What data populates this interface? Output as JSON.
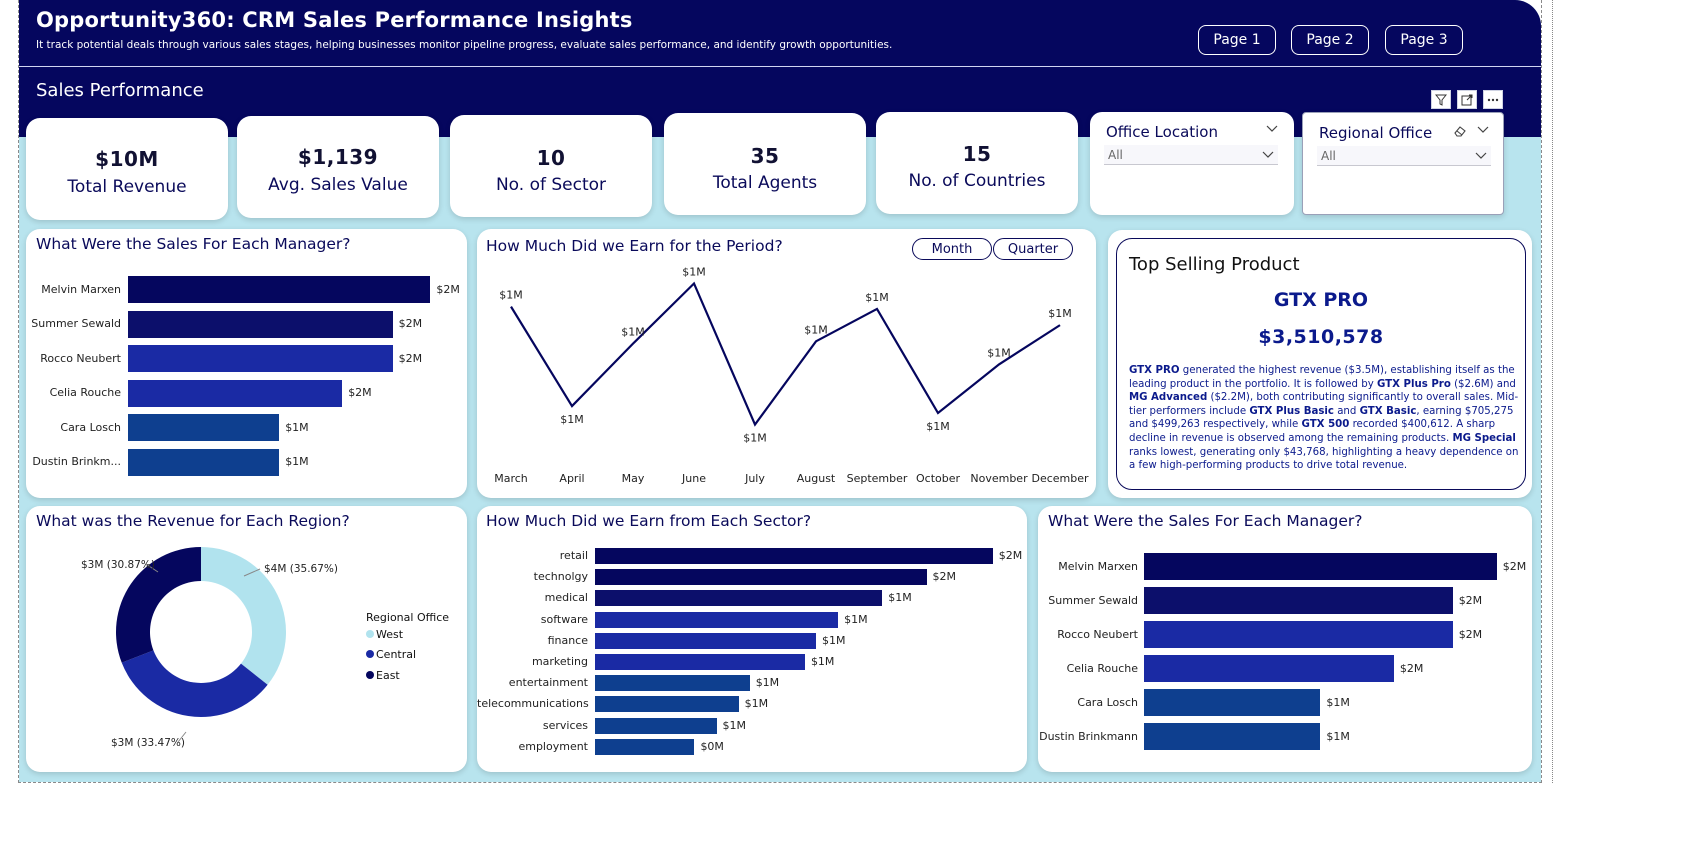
{
  "header": {
    "title": "Opportunity360: CRM Sales Performance Insights",
    "subtitle": "It track potential deals through various sales stages, helping businesses monitor pipeline progress, evaluate sales performance, and identify growth opportunities.",
    "section": "Sales Performance",
    "pages": [
      "Page 1",
      "Page 2",
      "Page 3"
    ],
    "visual_icons": [
      "filter-icon",
      "focus-mode-icon",
      "more-options-icon"
    ]
  },
  "kpis": [
    {
      "value": "$10M",
      "label": "Total Revenue"
    },
    {
      "value": "$1,139",
      "label": "Avg. Sales Value"
    },
    {
      "value": "10",
      "label": "No. of Sector"
    },
    {
      "value": "35",
      "label": "Total Agents"
    },
    {
      "value": "15",
      "label": "No. of Countries"
    }
  ],
  "slicers": [
    {
      "title": "Office Location",
      "selected": "All"
    },
    {
      "title": "Regional Office",
      "selected": "All"
    }
  ],
  "colors": {
    "navy": "#05065e",
    "dark_blue": "#0c0f6b",
    "royal_blue": "#1a2aa4",
    "mid_blue": "#0e3f8f",
    "light_blue": "#b1e3ee",
    "background": "#b8e4ee"
  },
  "manager_chart": {
    "title": "What Were the Sales For Each Manager?",
    "labels_full": [
      "Melvin Marxen",
      "Summer Sewald",
      "Rocco Neubert",
      "Celia Rouche",
      "Cara Losch",
      "Dustin Brinkmann"
    ],
    "labels_short": [
      "Melvin Marxen",
      "Summer Sewald",
      "Rocco Neubert",
      "Celia Rouche",
      "Cara Losch",
      "Dustin Brinkm..."
    ],
    "value_labels": [
      "$2M",
      "$2M",
      "$2M",
      "$2M",
      "$1M",
      "$1M"
    ]
  },
  "period_chart": {
    "title": "How Much Did we Earn for the Period?",
    "toggles": [
      "Month",
      "Quarter"
    ],
    "months": [
      "March",
      "April",
      "May",
      "June",
      "July",
      "August",
      "September",
      "October",
      "November",
      "December"
    ],
    "value_labels": [
      "$1M",
      "$1M",
      "$1M",
      "$1M",
      "$1M",
      "$1M",
      "$1M",
      "$1M",
      "$1M",
      "$1M"
    ]
  },
  "top_product": {
    "heading": "Top Selling Product",
    "name": "GTX PRO",
    "revenue": "$3,510,578",
    "t1": "GTX PRO",
    "t2": " generated the highest revenue ($3.5M), establishing itself as the leading product in the portfolio. It is followed by ",
    "t3": "GTX Plus Pro",
    "t4": " ($2.6M) and ",
    "t5": "MG Advanced",
    "t6": " ($2.2M), both contributing significantly to overall sales. Mid-tier performers include ",
    "t7": "GTX Plus Basic",
    "t8": " and ",
    "t9": "GTX Basic",
    "t10": ", earning $705,275 and $499,263 respectively, while ",
    "t11": "GTX 500",
    "t12": " recorded $400,612. A sharp decline in revenue is observed among the remaining products. ",
    "t13": "MG Special",
    "t14": " ranks lowest, generating only $43,768, highlighting a heavy dependence on a few high-performing products to drive total revenue."
  },
  "region_chart": {
    "title": "What was the Revenue for Each Region?",
    "legend_title": "Regional Office",
    "legend": [
      "West",
      "Central",
      "East"
    ],
    "slice_labels": [
      "$4M (35.67%)",
      "$3M (33.47%)",
      "$3M (30.87%)"
    ]
  },
  "sector_chart": {
    "title": "How Much Did we Earn from Each Sector?",
    "labels": [
      "retail",
      "technolgy",
      "medical",
      "software",
      "finance",
      "marketing",
      "entertainment",
      "telecommunications",
      "services",
      "employment"
    ],
    "value_labels": [
      "$2M",
      "$2M",
      "$1M",
      "$1M",
      "$1M",
      "$1M",
      "$1M",
      "$1M",
      "$1M",
      "$0M"
    ]
  },
  "chart_data": [
    {
      "type": "bar",
      "title": "What Were the Sales For Each Manager?",
      "categories": [
        "Melvin Marxen",
        "Summer Sewald",
        "Rocco Neubert",
        "Celia Rouche",
        "Cara Losch",
        "Dustin Brinkmann"
      ],
      "values": [
        2.4,
        2.1,
        2.1,
        1.7,
        1.2,
        1.2
      ]
    },
    {
      "type": "line",
      "title": "How Much Did we Earn for the Period?",
      "x": [
        "March",
        "April",
        "May",
        "June",
        "July",
        "August",
        "September",
        "October",
        "November",
        "December"
      ],
      "values": [
        1.02,
        0.59,
        0.86,
        1.12,
        0.51,
        0.87,
        1.01,
        0.56,
        0.77,
        0.94
      ]
    },
    {
      "type": "pie",
      "title": "What was the Revenue for Each Region?",
      "categories": [
        "West",
        "Central",
        "East"
      ],
      "values": [
        35.67,
        33.47,
        30.87
      ]
    },
    {
      "type": "bar",
      "title": "How Much Did we Earn from Each Sector?",
      "categories": [
        "retail",
        "technolgy",
        "medical",
        "software",
        "finance",
        "marketing",
        "entertainment",
        "telecommunications",
        "services",
        "employment"
      ],
      "values": [
        1.8,
        1.5,
        1.3,
        1.1,
        1.0,
        0.95,
        0.7,
        0.65,
        0.55,
        0.45
      ]
    },
    {
      "type": "bar",
      "title": "What Were the Sales For Each Manager?",
      "categories": [
        "Melvin Marxen",
        "Summer Sewald",
        "Rocco Neubert",
        "Celia Rouche",
        "Cara Losch",
        "Dustin Brinkmann"
      ],
      "values": [
        2.4,
        2.1,
        2.1,
        1.7,
        1.2,
        1.2
      ]
    }
  ]
}
